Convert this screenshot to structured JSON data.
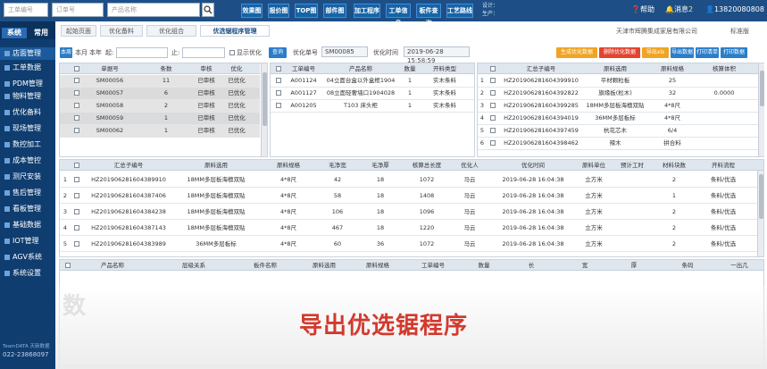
{
  "topbar": {
    "search_inputs": [
      "工单编号",
      "订单号",
      "产品名称"
    ],
    "search_icon": "search-icon",
    "func_buttons": [
      "效果图",
      "报价图",
      "TOP图",
      "部件图",
      "加工程序",
      "工单信息",
      "板件查询",
      "工艺路线"
    ],
    "design_label": "设计：",
    "production_label": "生产：",
    "help": "帮助",
    "messages": "消息",
    "message_count": "2",
    "user_phone": "13820080808"
  },
  "sidebar": {
    "tabs": [
      "系统",
      "常用"
    ],
    "items": [
      "店面管理",
      "工单数据",
      "PDM管理",
      "物料管理",
      "优化备料",
      "现场管理",
      "数控加工",
      "成本管控",
      "测尺安装",
      "售后管理",
      "看板管理",
      "基础数据",
      "IOT管理",
      "AGV系统",
      "系统设置"
    ],
    "footer_logo": "TeamDATA 天新数据",
    "footer_phone": "022-23868097"
  },
  "breadcrumb": {
    "tabs": [
      "起始页面",
      "优化备料",
      "优化组合",
      "优选锯程序管理"
    ],
    "company": "天津市辉腾集成家居有限公司",
    "edition": "标准版"
  },
  "filter": {
    "tabs": [
      "本周",
      "本月",
      "本年"
    ],
    "from_label": "起:",
    "to_label": "止:",
    "show_optimized": "显示优化",
    "query_button": "查询",
    "opt_no_label": "优化单号",
    "opt_no_value": "SM00085",
    "opt_time_label": "优化时间",
    "opt_time_value": "2019-06-28 15:58:59"
  },
  "action_buttons": [
    "生成优化数据",
    "删除优化数据",
    "导出xls",
    "导出数据",
    "打印清单",
    "打印数据"
  ],
  "table1": {
    "headers": [
      "单据号",
      "条数",
      "审核",
      "优化"
    ],
    "rows": [
      [
        "SM00056",
        "11",
        "已审核",
        "已优化"
      ],
      [
        "SM00057",
        "6",
        "已审核",
        "已优化"
      ],
      [
        "SM00058",
        "2",
        "已审核",
        "已优化"
      ],
      [
        "SM00059",
        "1",
        "已审核",
        "已优化"
      ],
      [
        "SM00062",
        "1",
        "已审核",
        "已优化"
      ]
    ]
  },
  "table2": {
    "headers": [
      "工单编号",
      "产品名称",
      "数量",
      "开料类型"
    ],
    "rows": [
      [
        "A001124",
        "04立面台盒以外盒框1904",
        "1",
        "实木条料"
      ],
      [
        "A001127",
        "08立面轻奢墙口1904028",
        "1",
        "实木条料"
      ],
      [
        "A001205",
        "T103 床头柜",
        "1",
        "实木条料"
      ]
    ]
  },
  "table3": {
    "headers": [
      "汇总子编号",
      "原料选用",
      "原料规格",
      "核算体积"
    ],
    "rows": [
      [
        "HZ201906281604399910",
        "平材颗粒板",
        "25",
        ""
      ],
      [
        "HZ201906281604392822",
        "旗缘板(松木)",
        "32",
        "0.0000"
      ],
      [
        "HZ201906281604399285",
        "18MM多层板海檀双贴",
        "4*8尺",
        ""
      ],
      [
        "HZ201906281604394019",
        "36MM多层板标",
        "4*8尺",
        ""
      ],
      [
        "HZ201906281604397459",
        "杭花芯木",
        "6/4",
        ""
      ],
      [
        "HZ201906281604398462",
        "辣木",
        "拼合料",
        ""
      ]
    ]
  },
  "table4": {
    "headers": [
      "汇总子编号",
      "原料选用",
      "原料规格",
      "毛净宽",
      "毛净厚",
      "核算总长度",
      "优化人",
      "优化时间",
      "原料单位",
      "预计工时",
      "材料块数",
      "开料流程"
    ],
    "rows": [
      [
        "HZ201906281604389910",
        "18MM多层板海檀双贴",
        "4*8尺",
        "42",
        "18",
        "1072",
        "马云",
        "2019-06-28 16:04:38",
        "立方米",
        "",
        "2",
        "条料/优选"
      ],
      [
        "HZ201906281604387406",
        "18MM多层板海檀双贴",
        "4*8尺",
        "58",
        "18",
        "1408",
        "马云",
        "2019-06-28 16:04:38",
        "立方米",
        "",
        "1",
        "条料/优选"
      ],
      [
        "HZ201906281604384238",
        "18MM多层板海檀双贴",
        "4*8尺",
        "106",
        "18",
        "1096",
        "马云",
        "2019-06-28 16:04:38",
        "立方米",
        "",
        "2",
        "条料/优选"
      ],
      [
        "HZ201906281604387143",
        "18MM多层板海檀双贴",
        "4*8尺",
        "467",
        "18",
        "1220",
        "马云",
        "2019-06-28 16:04:38",
        "立方米",
        "",
        "2",
        "条料/优选"
      ],
      [
        "HZ201906281604383989",
        "36MM多层板标",
        "4*8尺",
        "60",
        "36",
        "1072",
        "马云",
        "2019-06-28 16:04:38",
        "立方米",
        "",
        "2",
        "条料/优选"
      ]
    ]
  },
  "table5": {
    "headers": [
      "产品名称",
      "层级关系",
      "板件名称",
      "原料选用",
      "原料规格",
      "工单编号",
      "数量",
      "长",
      "宽",
      "厚",
      "条码",
      "一出几"
    ]
  },
  "caption": "导出优选锯程序",
  "watermark": "数"
}
